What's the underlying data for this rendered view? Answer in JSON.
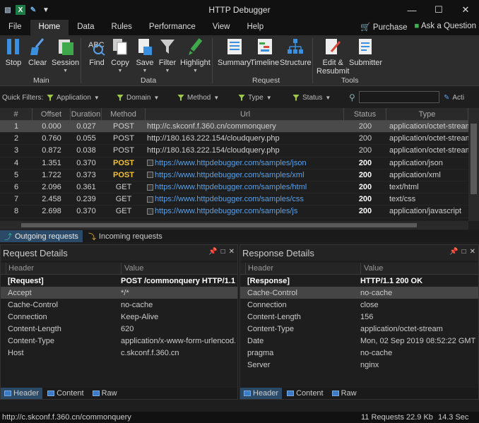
{
  "window": {
    "title": "HTTP Debugger"
  },
  "menu": {
    "tabs": [
      "File",
      "Home",
      "Data",
      "Rules",
      "Performance",
      "View",
      "Help"
    ],
    "active": "Home",
    "purchase": "Purchase",
    "ask": "Ask a Question"
  },
  "ribbon": {
    "buttons": [
      "Stop",
      "Clear",
      "Session",
      "Find",
      "Copy",
      "Save",
      "Filter",
      "Highlight",
      "Summary",
      "Timeline",
      "Structure",
      "Edit &",
      "Resubmit",
      "Submitter"
    ],
    "groups": [
      "Main",
      "Data",
      "Request",
      "Tools"
    ]
  },
  "filters": {
    "label": "Quick Filters:",
    "items": [
      "Application",
      "Domain",
      "Method",
      "Type",
      "Status"
    ],
    "search_placeholder": "",
    "activate": "Acti"
  },
  "table": {
    "headers": [
      "#",
      "Offset",
      "Duration",
      "Method",
      "Url",
      "Status",
      "Type"
    ],
    "rows": [
      [
        "1",
        "0.000",
        "0.027",
        "POST",
        "http://c.skconf.f.360.cn/commonquery",
        "200",
        "application/octet-stream"
      ],
      [
        "2",
        "0.760",
        "0.055",
        "POST",
        "http://180.163.222.154/cloudquery.php",
        "200",
        "application/octet-stream"
      ],
      [
        "3",
        "0.872",
        "0.038",
        "POST",
        "http://180.163.222.154/cloudquery.php",
        "200",
        "application/octet-stream"
      ],
      [
        "4",
        "1.351",
        "0.370",
        "POST",
        "https://www.httpdebugger.com/samples/json",
        "200",
        "application/json"
      ],
      [
        "5",
        "1.722",
        "0.373",
        "POST",
        "https://www.httpdebugger.com/samples/xml",
        "200",
        "application/xml"
      ],
      [
        "6",
        "2.096",
        "0.361",
        "GET",
        "https://www.httpdebugger.com/samples/html",
        "200",
        "text/html"
      ],
      [
        "7",
        "2.458",
        "0.239",
        "GET",
        "https://www.httpdebugger.com/samples/css",
        "200",
        "text/css"
      ],
      [
        "8",
        "2.698",
        "0.370",
        "GET",
        "https://www.httpdebugger.com/samples/js",
        "200",
        "application/javascript"
      ]
    ]
  },
  "direction_tabs": [
    "Outgoing requests",
    "Incoming requests"
  ],
  "request": {
    "title": "Request Details",
    "headers": [
      "Header",
      "Value"
    ],
    "rows": [
      [
        "[Request]",
        "POST /commonquery HTTP/1.1"
      ],
      [
        "Accept",
        "*/*"
      ],
      [
        "Cache-Control",
        "no-cache"
      ],
      [
        "Connection",
        "Keep-Alive"
      ],
      [
        "Content-Length",
        "620"
      ],
      [
        "Content-Type",
        "application/x-www-form-urlencod..."
      ],
      [
        "Host",
        "c.skconf.f.360.cn"
      ]
    ],
    "tabs": [
      "Header",
      "Content",
      "Raw"
    ]
  },
  "response": {
    "title": "Response Details",
    "headers": [
      "Header",
      "Value"
    ],
    "rows": [
      [
        "[Response]",
        "HTTP/1.1 200 OK"
      ],
      [
        "Cache-Control",
        "no-cache"
      ],
      [
        "Connection",
        "close"
      ],
      [
        "Content-Length",
        "156"
      ],
      [
        "Content-Type",
        "application/octet-stream"
      ],
      [
        "Date",
        "Mon, 02 Sep 2019 08:52:22 GMT"
      ],
      [
        "pragma",
        "no-cache"
      ],
      [
        "Server",
        "nginx"
      ]
    ],
    "tabs": [
      "Header",
      "Content",
      "Raw"
    ]
  },
  "status": {
    "url": "http://c.skconf.f.360.cn/commonquery",
    "requests": "11 Requests",
    "size": "22.9 Kb",
    "time": "14.3 Sec"
  },
  "colors": {
    "accent": "#2b4a67",
    "link": "#5aa0e6",
    "post_highlight": "#f3c233"
  }
}
